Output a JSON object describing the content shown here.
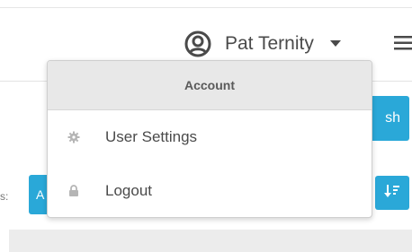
{
  "navbar": {
    "user": {
      "name": "Pat Ternity",
      "avatar_icon": "user-circle-icon",
      "caret_icon": "caret-down-icon"
    },
    "menu_icon": "hamburger-icon"
  },
  "dropdown": {
    "header": "Account",
    "items": [
      {
        "label": "User Settings",
        "icon": "gear-icon"
      },
      {
        "label": "Logout",
        "icon": "lock-icon"
      }
    ]
  },
  "background": {
    "action_button_partial_label": "sh",
    "filter_label_partial": "s:",
    "filter_button_partial_label": "A",
    "sort_icon": "sort-descending-icon"
  },
  "colors": {
    "accent": "#2aa8d8",
    "header_bg": "#e8e8e8",
    "text": "#4a4a4a"
  }
}
